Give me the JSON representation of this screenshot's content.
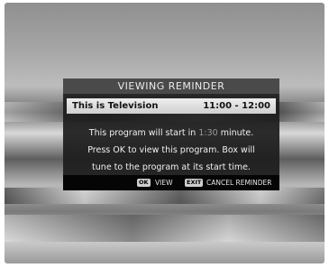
{
  "dialog": {
    "title": "VIEWING REMINDER",
    "program_name": "This is Television",
    "time_range": "11:00 - 12:00",
    "message_line1_pre": "This program will start in ",
    "message_minutes": "1:30",
    "message_line1_post": " minute.",
    "message_line2": "Press OK to view this program. Box will",
    "message_line3": "tune to the program at its start time."
  },
  "footer": {
    "ok_key": "OK",
    "view_label": "VIEW",
    "exit_key": "EXIT",
    "cancel_label": "CANCEL REMINDER"
  }
}
